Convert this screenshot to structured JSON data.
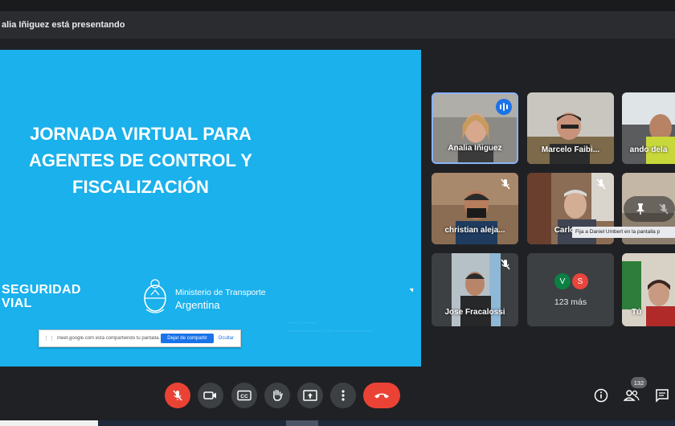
{
  "header": {
    "presenting_text": "alia Iñiguez está presentando"
  },
  "slide": {
    "title_lines": [
      "JORNADA VIRTUAL PARA",
      "AGENTES DE CONTROL Y",
      "FISCALIZACIÓN"
    ],
    "logo_line1": "SEGURIDAD",
    "logo_line2": "VIAL",
    "ministry_line1": "Ministerio de Transporte",
    "ministry_line2": "Argentina"
  },
  "share_banner": {
    "message": "meet.google.com está compartiendo tu pantalla.",
    "stop_label": "Dejar de compartir",
    "hide_label": "Ocultar"
  },
  "participants": [
    {
      "name": "Analia Iñiguez",
      "speaking": true,
      "muted": false
    },
    {
      "name": "Marcelo Faibi...",
      "muted": false
    },
    {
      "name": "ando dela",
      "muted": false
    },
    {
      "name": "christian aleja...",
      "muted": true
    },
    {
      "name": "Carlos S",
      "muted": true
    },
    {
      "name": "",
      "muted": true
    },
    {
      "name": "Jose Fracalossi",
      "muted": true
    },
    {
      "name": "Tú",
      "muted": false
    }
  ],
  "pin_tooltip": "Fija a Daniel Umbert en la pantalla p",
  "more_tile": {
    "avatars": [
      {
        "letter": "V",
        "color": "#0b8043"
      },
      {
        "letter": "S",
        "color": "#e8453c"
      }
    ],
    "label": "123 más"
  },
  "toolbar": {
    "participant_count": "132",
    "buttons": [
      "mic-off-icon",
      "camera-icon",
      "captions-icon",
      "raise-hand-icon",
      "present-icon",
      "more-options-icon",
      "end-call-icon"
    ]
  },
  "colors": {
    "slide_bg": "#1ab1ec",
    "accent_blue": "#1a73e8",
    "end_red": "#ea4335",
    "tile_bg": "#3c4043",
    "page_bg": "#202124"
  }
}
